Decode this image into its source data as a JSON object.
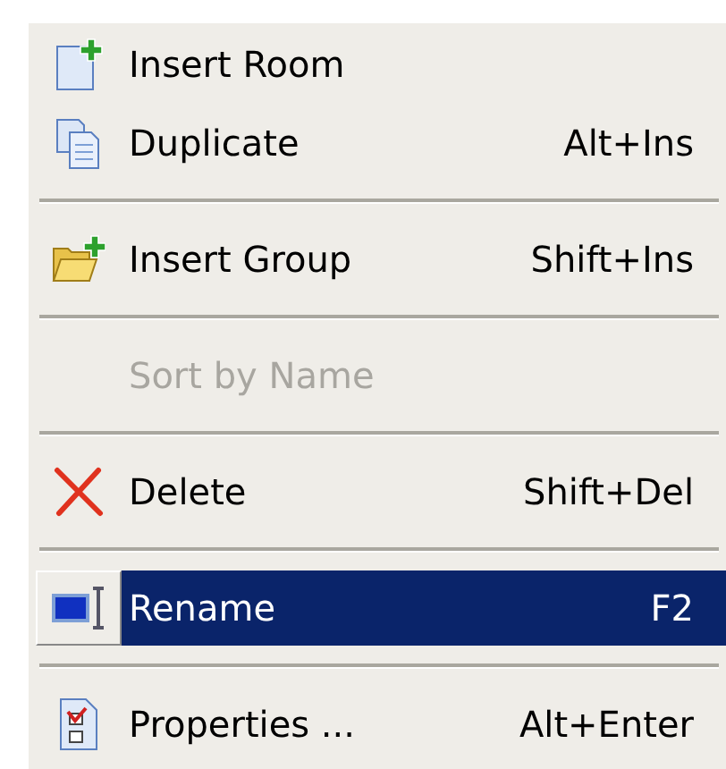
{
  "menu": {
    "items": [
      {
        "kind": "item",
        "label": "Insert Room",
        "disabled": false,
        "selected": false
      },
      {
        "kind": "item",
        "label": "Duplicate",
        "shortcut": "Alt+Ins",
        "disabled": false,
        "selected": false
      },
      {
        "kind": "separator"
      },
      {
        "kind": "item",
        "label": "Insert Group",
        "shortcut": "Shift+Ins",
        "disabled": false,
        "selected": false
      },
      {
        "kind": "separator"
      },
      {
        "kind": "item",
        "label": "Sort by Name",
        "disabled": true,
        "selected": false
      },
      {
        "kind": "separator"
      },
      {
        "kind": "item",
        "label": "Delete",
        "shortcut": "Shift+Del",
        "disabled": false,
        "selected": false
      },
      {
        "kind": "separator"
      },
      {
        "kind": "item",
        "label": "Rename",
        "shortcut": "F2",
        "disabled": false,
        "selected": true
      },
      {
        "kind": "separator"
      },
      {
        "kind": "item",
        "label": "Properties ...",
        "shortcut": "Alt+Enter",
        "disabled": false,
        "selected": false
      }
    ]
  }
}
